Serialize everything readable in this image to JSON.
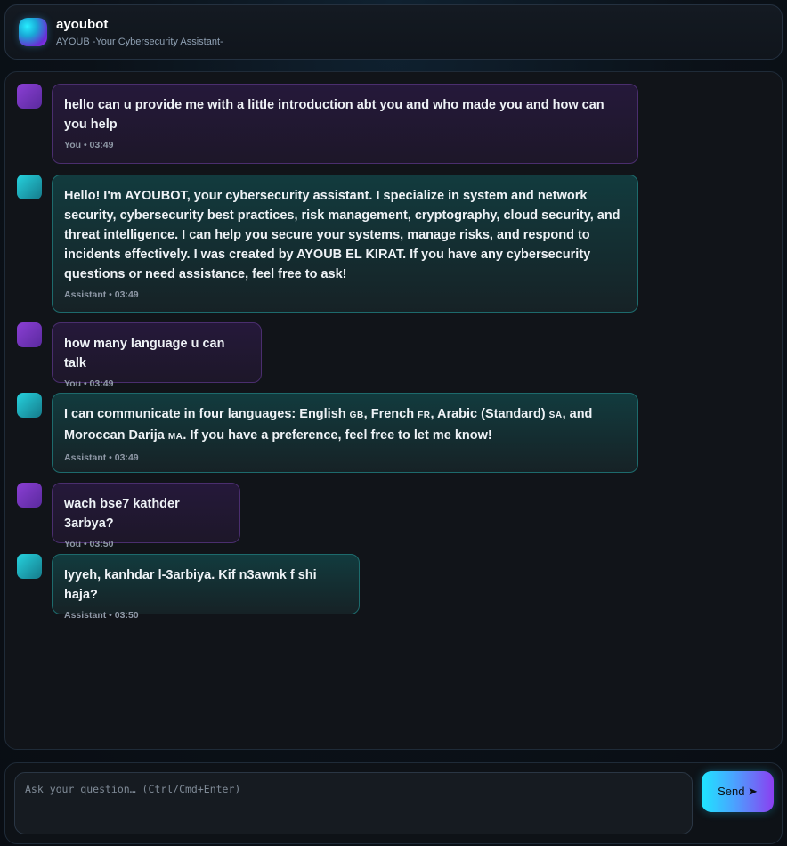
{
  "header": {
    "title": "ayoubot",
    "subtitle": "AYOUB -Your Cybersecurity Assistant-"
  },
  "messages": [
    {
      "role": "user",
      "text": "hello can u provide me with a little introduction abt you and who made you and how can you help",
      "meta": "You • 03:49"
    },
    {
      "role": "assistant",
      "text": "Hello! I'm AYOUBOT, your cybersecurity assistant. I specialize in system and network security, cybersecurity best practices, risk management, cryptography, cloud security, and threat intelligence. I can help you secure your systems, manage risks, and respond to incidents effectively. I was created by AYOUB EL KIRAT. If you have any cybersecurity questions or need assistance, feel free to ask!",
      "meta": "Assistant • 03:49"
    },
    {
      "role": "user",
      "text": "how many language u can talk",
      "meta": "You • 03:49"
    },
    {
      "role": "assistant",
      "text_parts": {
        "a": "I can communicate in four languages: English ",
        "flag_gb": "GB",
        "b": ", French ",
        "flag_fr": "FR",
        "c": ", Arabic (Standard) ",
        "flag_sa": "SA",
        "d": ", and Moroccan Darija ",
        "flag_ma": "MA",
        "e": ". If you have a preference, feel free to let me know!"
      },
      "meta": "Assistant • 03:49"
    },
    {
      "role": "user",
      "text": "wach bse7 kathder 3arbya?",
      "meta": "You • 03:50"
    },
    {
      "role": "assistant",
      "text": "Iyyeh, kanhdar l-3arbiya. Kif n3awnk f shi haja?",
      "meta": "Assistant • 03:50"
    }
  ],
  "composer": {
    "placeholder": "Ask your question… (Ctrl/Cmd+Enter)",
    "send_label": "Send ➤"
  },
  "colors": {
    "accent_cyan": "#1ee6ff",
    "accent_purple": "#8b3ff0",
    "user_bubble_border": "#4a2e6e",
    "assistant_bubble_border": "#1d6a6c"
  }
}
